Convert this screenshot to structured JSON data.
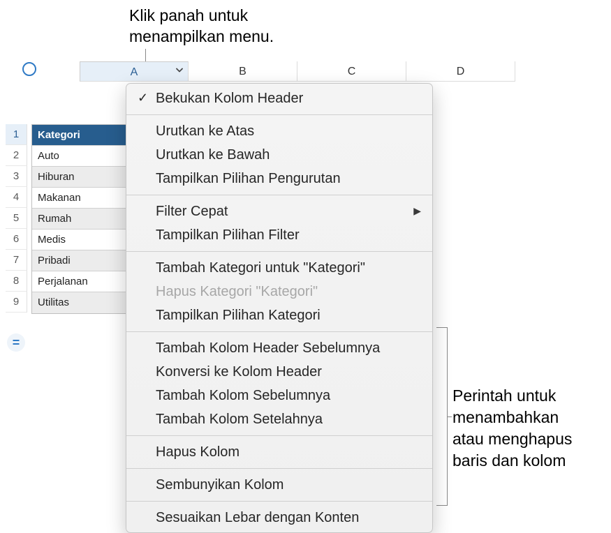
{
  "callouts": {
    "top": "Klik panah untuk\nmenampilkan menu.",
    "right": "Perintah untuk\nmenambahkan\natau menghapus\nbaris dan kolom"
  },
  "columns": [
    "A",
    "B",
    "C",
    "D"
  ],
  "row_numbers": [
    "1",
    "2",
    "3",
    "4",
    "5",
    "6",
    "7",
    "8",
    "9"
  ],
  "table": {
    "header": "Kategori",
    "rows": [
      "Auto",
      "Hiburan",
      "Makanan",
      "Rumah",
      "Medis",
      "Pribadi",
      "Perjalanan",
      "Utilitas"
    ]
  },
  "menu": {
    "freeze": "Bekukan Kolom Header",
    "sort_asc": "Urutkan ke Atas",
    "sort_desc": "Urutkan ke Bawah",
    "sort_opts": "Tampilkan Pilihan Pengurutan",
    "quick_filter": "Filter Cepat",
    "filter_opts": "Tampilkan Pilihan Filter",
    "add_cat": "Tambah Kategori untuk \"Kategori\"",
    "del_cat": "Hapus Kategori \"Kategori\"",
    "cat_opts": "Tampilkan Pilihan Kategori",
    "add_header_before": "Tambah Kolom Header Sebelumnya",
    "convert_header": "Konversi ke Kolom Header",
    "add_before": "Tambah Kolom Sebelumnya",
    "add_after": "Tambah Kolom Setelahnya",
    "delete_col": "Hapus Kolom",
    "hide_col": "Sembunyikan Kolom",
    "fit_width": "Sesuaikan Lebar dengan Konten"
  },
  "icons": {
    "equals": "="
  }
}
